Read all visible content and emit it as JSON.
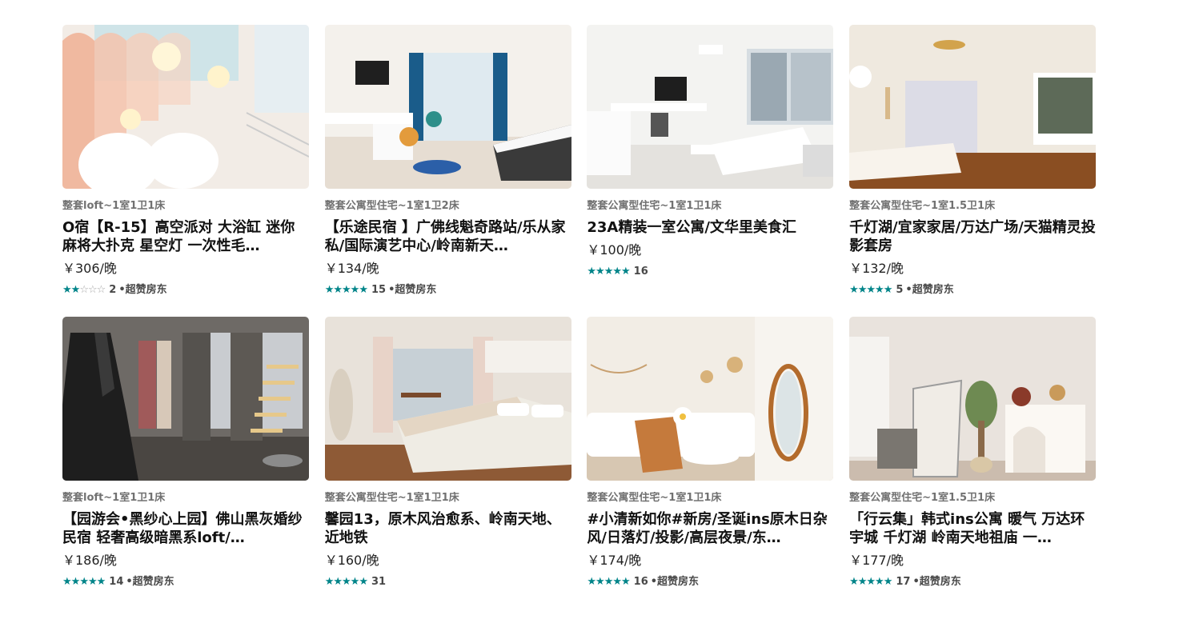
{
  "listings": [
    {
      "photo": "loft-white-arches-cloud-lamps",
      "type": "整套loft~1室1卫1床",
      "title": "O宿【R-15】高空派对 大浴缸 迷你麻将大扑克 星空灯 一次性毛…",
      "price": "￥306/晚",
      "stars_rating": 2,
      "stars_text": [
        "★",
        "★",
        "☆",
        "☆",
        "☆"
      ],
      "review_count": "2",
      "host": "•超赞房东"
    },
    {
      "photo": "apartment-blue-curtains-checkered-bed",
      "type": "整套公寓型住宅~1室1卫2床",
      "title": "【乐途民宿 】广佛线魁奇路站/乐从家私/国际演艺中心/岭南新天…",
      "price": "￥134/晚",
      "stars_rating": 5,
      "stars_text": [
        "★",
        "★",
        "★",
        "★",
        "★"
      ],
      "review_count": "15",
      "host": "•超赞房东"
    },
    {
      "photo": "apartment-desk-tv-grey-chair",
      "type": "整套公寓型住宅~1室1卫1床",
      "title": "23A精装一室公寓/文华里美食汇",
      "price": "￥100/晚",
      "stars_rating": 5,
      "stars_text": [
        "★",
        "★",
        "★",
        "★",
        "★"
      ],
      "review_count": "16",
      "host": ""
    },
    {
      "photo": "room-projector-screen-wood-floor",
      "type": "整套公寓型住宅~1室1.5卫1床",
      "title": "千灯湖/宜家家居/万达广场/天猫精灵投影套房",
      "price": "￥132/晚",
      "stars_rating": 5,
      "stars_text": [
        "★",
        "★",
        "★",
        "★",
        "★"
      ],
      "review_count": "5",
      "host": "•超赞房东"
    },
    {
      "photo": "loft-black-dress-spiral-stairs",
      "type": "整套loft~1室1卫1床",
      "title": "【园游会•黑纱心上园】佛山黑灰婚纱民宿 轻奢高级暗黑系loft/…",
      "price": "￥186/晚",
      "stars_rating": 5,
      "stars_text": [
        "★",
        "★",
        "★",
        "★",
        "★"
      ],
      "review_count": "14",
      "host": "•超赞房东"
    },
    {
      "photo": "bedroom-canopy-floral-bedding",
      "type": "整套公寓型住宅~1室1卫1床",
      "title": "馨园13，原木风治愈系、岭南天地、近地铁",
      "price": "￥160/晚",
      "stars_rating": 5,
      "stars_text": [
        "★",
        "★",
        "★",
        "★",
        "★"
      ],
      "review_count": "31",
      "host": ""
    },
    {
      "photo": "living-room-rattan-mirror-sofa",
      "type": "整套公寓型住宅~1室1卫1床",
      "title": "#小清新如你#新房/圣诞ins原木日杂风/日落灯/投影/高层夜景/东…",
      "price": "￥174/晚",
      "stars_rating": 5,
      "stars_text": [
        "★",
        "★",
        "★",
        "★",
        "★"
      ],
      "review_count": "16",
      "host": "•超赞房东"
    },
    {
      "photo": "studio-arch-shelf-plant",
      "type": "整套公寓型住宅~1室1.5卫1床",
      "title": "「行云集」韩式ins公寓 暖气 万达环宇城 千灯湖 岭南天地祖庙 一…",
      "price": "￥177/晚",
      "stars_rating": 5,
      "stars_text": [
        "★",
        "★",
        "★",
        "★",
        "★"
      ],
      "review_count": "17",
      "host": "•超赞房东"
    }
  ],
  "colors": {
    "star": "#008489",
    "star_off": "#a8a8a8",
    "type_text": "#717171"
  }
}
